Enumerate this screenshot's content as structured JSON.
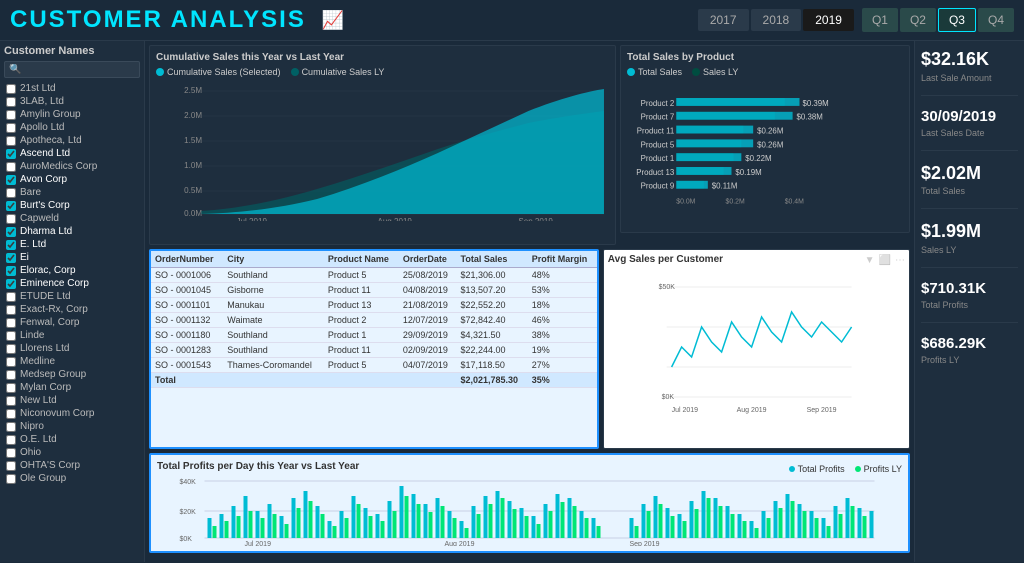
{
  "header": {
    "title": "CUSTOMER ANALYSIS",
    "icon": "📈",
    "years": [
      "2017",
      "2018",
      "2019"
    ],
    "activeYear": "2019",
    "quarters": [
      "Q1",
      "Q2",
      "Q3",
      "Q4"
    ],
    "activeQuarter": "Q3"
  },
  "sidebar": {
    "title": "Customer Names",
    "searchPlaceholder": "🔍",
    "customers": [
      {
        "name": "21st Ltd",
        "checked": false
      },
      {
        "name": "3LAB, Ltd",
        "checked": false
      },
      {
        "name": "Amylin Group",
        "checked": false
      },
      {
        "name": "Apollo Ltd",
        "checked": false
      },
      {
        "name": "Apotheca, Ltd",
        "checked": false
      },
      {
        "name": "Ascend Ltd",
        "checked": true
      },
      {
        "name": "AuroMedics Corp",
        "checked": false
      },
      {
        "name": "Avon Corp",
        "checked": true
      },
      {
        "name": "Bare",
        "checked": false
      },
      {
        "name": "Burt's Corp",
        "checked": true
      },
      {
        "name": "Capweld",
        "checked": false
      },
      {
        "name": "Dharma Ltd",
        "checked": true
      },
      {
        "name": "E. Ltd",
        "checked": true
      },
      {
        "name": "Ei",
        "checked": true
      },
      {
        "name": "Elorac, Corp",
        "checked": true
      },
      {
        "name": "Eminence Corp",
        "checked": true
      },
      {
        "name": "ETUDE Ltd",
        "checked": false
      },
      {
        "name": "Exact-Rx, Corp",
        "checked": false
      },
      {
        "name": "Fenwal, Corp",
        "checked": false
      },
      {
        "name": "Linde",
        "checked": false
      },
      {
        "name": "Llorens Ltd",
        "checked": false
      },
      {
        "name": "Medline",
        "checked": false
      },
      {
        "name": "Medsep Group",
        "checked": false
      },
      {
        "name": "Mylan Corp",
        "checked": false
      },
      {
        "name": "New Ltd",
        "checked": false
      },
      {
        "name": "Niconovum Corp",
        "checked": false
      },
      {
        "name": "Nipro",
        "checked": false
      },
      {
        "name": "O.E. Ltd",
        "checked": false
      },
      {
        "name": "Ohio",
        "checked": false
      },
      {
        "name": "OHTA'S Corp",
        "checked": false
      },
      {
        "name": "Ole Group",
        "checked": false
      }
    ]
  },
  "cumulative_chart": {
    "title": "Cumulative Sales this Year vs Last Year",
    "legend": [
      {
        "label": "Cumulative Sales (Selected)",
        "color": "#00bcd4"
      },
      {
        "label": "Cumulative Sales LY",
        "color": "#006064"
      }
    ],
    "x_labels": [
      "Jul 2019",
      "Aug 2019",
      "Sep 2019"
    ],
    "y_labels": [
      "2.5M",
      "2.0M",
      "1.5M",
      "1.0M",
      "0.5M",
      "0.0M"
    ]
  },
  "total_sales_chart": {
    "title": "Total Sales by Product",
    "legend": [
      {
        "label": "Total Sales",
        "color": "#00bcd4"
      },
      {
        "label": "Sales LY",
        "color": "#004d40"
      }
    ],
    "products": [
      {
        "name": "Product 2",
        "sales": 0.39,
        "ly": 0.36
      },
      {
        "name": "Product 7",
        "sales": 0.38,
        "ly": 0.34
      },
      {
        "name": "Product 11",
        "sales": 0.26,
        "ly": 0.23
      },
      {
        "name": "Product 5",
        "sales": 0.26,
        "ly": 0.22
      },
      {
        "name": "Product 1",
        "sales": 0.22,
        "ly": 0.19
      },
      {
        "name": "Product 13",
        "sales": 0.19,
        "ly": 0.16
      },
      {
        "name": "Product 9",
        "sales": 0.11,
        "ly": 0.1
      }
    ],
    "labels": {
      "Product 2": "$0.39M",
      "Product 7": "$0.38M",
      "Product 11": "$0.26M",
      "Product 5": "$0.26M",
      "Product 1": "$0.22M",
      "Product 13": "$0.19M",
      "Product 9": "$0.11M"
    }
  },
  "table": {
    "headers": [
      "OrderNumber",
      "City",
      "Product Name",
      "OrderDate",
      "Total Sales",
      "Profit Margin"
    ],
    "rows": [
      [
        "SO - 0001006",
        "Southland",
        "Product 5",
        "25/08/2019",
        "$21,306.00",
        "48%"
      ],
      [
        "SO - 0001045",
        "Gisborne",
        "Product 11",
        "04/08/2019",
        "$13,507.20",
        "53%"
      ],
      [
        "SO - 0001101",
        "Manukau",
        "Product 13",
        "21/08/2019",
        "$22,552.20",
        "18%"
      ],
      [
        "SO - 0001132",
        "Waimate",
        "Product 2",
        "12/07/2019",
        "$72,842.40",
        "46%"
      ],
      [
        "SO - 0001180",
        "Southland",
        "Product 1",
        "29/09/2019",
        "$4,321.50",
        "38%"
      ],
      [
        "SO - 0001283",
        "Southland",
        "Product 11",
        "02/09/2019",
        "$22,244.00",
        "19%"
      ],
      [
        "SO - 0001543",
        "Thames-Coromandel",
        "Product 5",
        "04/07/2019",
        "$17,118.50",
        "27%"
      ]
    ],
    "total_row": [
      "Total",
      "",
      "",
      "",
      "$2,021,785.30",
      "35%"
    ]
  },
  "avg_sales": {
    "title": "Avg Sales per Customer",
    "y_labels": [
      "$50K",
      "$0K"
    ],
    "x_labels": [
      "Jul 2019",
      "Aug 2019",
      "Sep 2019"
    ]
  },
  "total_profits": {
    "title": "Total Profits per Day this Year vs Last Year",
    "legend": [
      {
        "label": "Total Profits",
        "color": "#00bcd4"
      },
      {
        "label": "Profits LY",
        "color": "#00e676"
      }
    ],
    "y_labels": [
      "$40K",
      "$20K",
      "$0K"
    ],
    "x_labels": [
      "Jul 2019",
      "Aug 2019",
      "Sep 2019"
    ]
  },
  "stats": [
    {
      "value": "$32.16K",
      "label": "Last Sale Amount"
    },
    {
      "value": "30/09/2019",
      "label": "Last Sales Date"
    },
    {
      "value": "$2.02M",
      "label": "Total Sales"
    },
    {
      "value": "$1.99M",
      "label": "Sales LY"
    },
    {
      "value": "$710.31K",
      "label": "Total Profits"
    },
    {
      "value": "$686.29K",
      "label": "Profits LY"
    }
  ]
}
